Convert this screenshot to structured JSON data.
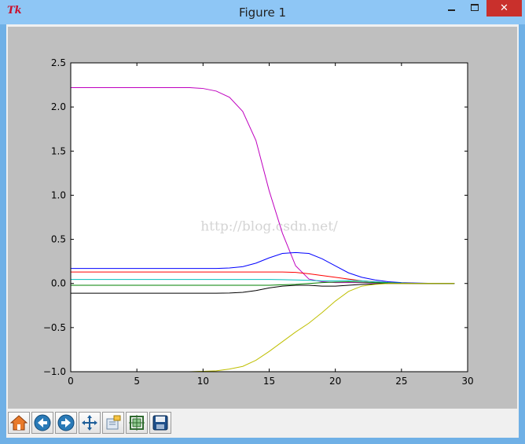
{
  "window": {
    "title": "Figure 1",
    "app_icon": "tk-icon",
    "app_icon_text": "Tk",
    "close_label": "✕"
  },
  "toolbar": {
    "buttons": [
      {
        "icon": "home-icon",
        "label": "Home"
      },
      {
        "icon": "back-arrow-icon",
        "label": "Back"
      },
      {
        "icon": "forward-arrow-icon",
        "label": "Forward"
      },
      {
        "icon": "pan-icon",
        "label": "Pan"
      },
      {
        "icon": "zoom-icon",
        "label": "Zoom"
      },
      {
        "icon": "subplots-icon",
        "label": "Subplots"
      },
      {
        "icon": "save-icon",
        "label": "Save"
      }
    ]
  },
  "watermark": "http://blog.csdn.net/",
  "chart_data": {
    "type": "line",
    "title": "",
    "xlabel": "",
    "ylabel": "",
    "xlim": [
      0,
      30
    ],
    "ylim": [
      -1.0,
      2.5
    ],
    "xticks": [
      "0",
      "5",
      "10",
      "15",
      "20",
      "25",
      "30"
    ],
    "yticks": [
      "−1.0",
      "−0.5",
      "0.0",
      "0.5",
      "1.0",
      "1.5",
      "2.0",
      "2.5"
    ],
    "grid": false,
    "legend": "none",
    "x": [
      0,
      1,
      2,
      3,
      4,
      5,
      6,
      7,
      8,
      9,
      10,
      11,
      12,
      13,
      14,
      15,
      16,
      17,
      18,
      19,
      20,
      21,
      22,
      23,
      24,
      25,
      26,
      27,
      28,
      29
    ],
    "series": [
      {
        "color": "#bf00bf",
        "values": [
          2.22,
          2.22,
          2.22,
          2.22,
          2.22,
          2.22,
          2.22,
          2.22,
          2.22,
          2.22,
          2.21,
          2.18,
          2.11,
          1.95,
          1.62,
          1.05,
          0.57,
          0.2,
          0.05,
          0.02,
          0.01,
          0.01,
          0.01,
          0.005,
          0.003,
          0.002,
          0.001,
          0.0,
          0.0,
          0.0
        ]
      },
      {
        "color": "#0000ff",
        "values": [
          0.17,
          0.17,
          0.17,
          0.17,
          0.17,
          0.17,
          0.17,
          0.17,
          0.17,
          0.17,
          0.17,
          0.17,
          0.175,
          0.19,
          0.23,
          0.29,
          0.34,
          0.35,
          0.34,
          0.28,
          0.2,
          0.12,
          0.07,
          0.04,
          0.02,
          0.01,
          0.005,
          0.002,
          0.001,
          0.0
        ]
      },
      {
        "color": "#ff0000",
        "values": [
          0.13,
          0.13,
          0.13,
          0.13,
          0.13,
          0.13,
          0.13,
          0.13,
          0.13,
          0.13,
          0.13,
          0.13,
          0.13,
          0.13,
          0.13,
          0.13,
          0.13,
          0.125,
          0.11,
          0.09,
          0.07,
          0.05,
          0.03,
          0.02,
          0.01,
          0.005,
          0.002,
          0.001,
          0.0,
          0.0
        ]
      },
      {
        "color": "#00bfbf",
        "values": [
          0.045,
          0.045,
          0.045,
          0.045,
          0.045,
          0.045,
          0.045,
          0.045,
          0.045,
          0.045,
          0.045,
          0.045,
          0.045,
          0.045,
          0.045,
          0.045,
          0.043,
          0.04,
          0.035,
          0.03,
          0.03,
          0.035,
          0.03,
          0.02,
          0.01,
          0.005,
          0.002,
          0.001,
          0.0,
          0.0
        ]
      },
      {
        "color": "#008000",
        "values": [
          -0.02,
          -0.02,
          -0.02,
          -0.02,
          -0.02,
          -0.02,
          -0.02,
          -0.02,
          -0.02,
          -0.02,
          -0.02,
          -0.02,
          -0.02,
          -0.02,
          -0.02,
          -0.02,
          -0.015,
          -0.01,
          0.0,
          0.01,
          0.015,
          0.02,
          0.015,
          0.01,
          0.005,
          0.002,
          0.001,
          0.0,
          0.0,
          0.0
        ]
      },
      {
        "color": "#000000",
        "values": [
          -0.11,
          -0.11,
          -0.11,
          -0.11,
          -0.11,
          -0.11,
          -0.11,
          -0.11,
          -0.11,
          -0.11,
          -0.11,
          -0.11,
          -0.108,
          -0.1,
          -0.08,
          -0.05,
          -0.03,
          -0.02,
          -0.02,
          -0.03,
          -0.03,
          -0.02,
          -0.01,
          -0.005,
          0.0,
          0.0,
          0.0,
          0.0,
          0.0,
          0.0
        ]
      },
      {
        "color": "#bfbf00",
        "values": [
          -1.0,
          -1.0,
          -1.0,
          -1.0,
          -1.0,
          -1.0,
          -1.0,
          -1.0,
          -1.0,
          -1.0,
          -0.995,
          -0.99,
          -0.97,
          -0.94,
          -0.87,
          -0.77,
          -0.66,
          -0.55,
          -0.45,
          -0.33,
          -0.2,
          -0.09,
          -0.03,
          -0.01,
          0.0,
          0.0,
          0.0,
          0.0,
          0.0,
          0.0
        ]
      }
    ]
  }
}
